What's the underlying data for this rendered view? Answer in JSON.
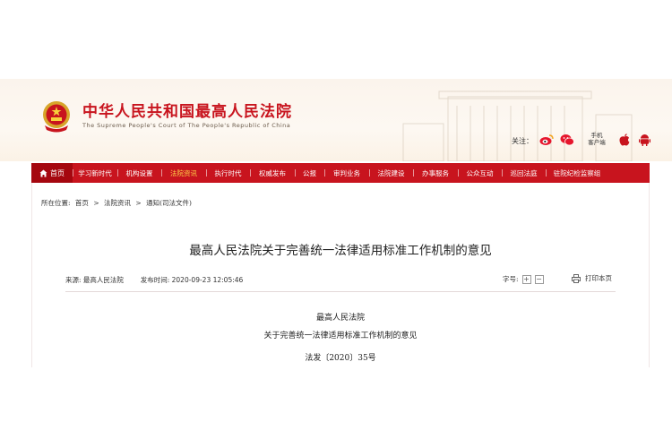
{
  "header": {
    "title": "中华人民共和国最高人民法院",
    "subtitle": "The Supreme People's Court of The People's Republic of China",
    "follow_label": "关注：",
    "mobile_label_line1": "手机",
    "mobile_label_line2": "客户端",
    "icons": [
      "emblem-icon",
      "weibo-icon",
      "wechat-icon",
      "mobile-phone-icon",
      "apple-icon",
      "android-icon"
    ]
  },
  "nav": {
    "home": "首页",
    "items": [
      "学习新时代",
      "机构设置",
      "法院资讯",
      "执行时代",
      "权威发布",
      "公报",
      "审判业务",
      "法院建设",
      "办事服务",
      "公众互动",
      "巡回法庭",
      "驻院纪检监察组"
    ],
    "active_index": 2
  },
  "breadcrumb": {
    "prefix": "所在位置:",
    "items": [
      "首页",
      "法院资讯",
      "通知(司法文件)"
    ],
    "separator": ">"
  },
  "article": {
    "title": "最高人民法院关于完善统一法律适用标准工作机制的意见",
    "source_label": "来源:",
    "source": "最高人民法院",
    "publish_label": "发布时间:",
    "publish_time": "2020-09-23 12:05:46",
    "font_size_label": "字号:",
    "font_increase": "+",
    "font_decrease": "−",
    "print_label": "打印本页",
    "body": {
      "issuer": "最高人民法院",
      "doc_title": "关于完善统一法律适用标准工作机制的意见",
      "doc_number": "法发〔2020〕35号"
    }
  },
  "colors": {
    "brand_red": "#c8141e",
    "home_red": "#a5070f",
    "active_nav": "#ffd24a"
  }
}
